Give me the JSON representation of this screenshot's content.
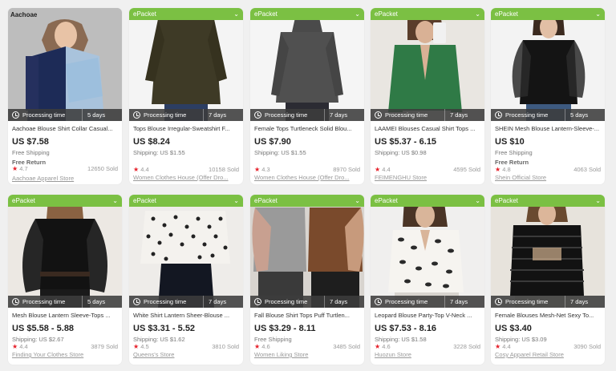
{
  "labels": {
    "epacket": "ePacket",
    "processing": "Processing time",
    "chevron": "⌄"
  },
  "colors": {
    "epacket_bg": "#7bc043",
    "star": "#e6212b",
    "processing_bg": "#3c3c3c"
  },
  "products": [
    {
      "brand_tag": "Aachoae",
      "epacket": false,
      "days": "5 days",
      "title": "Aachoae Blouse Shirt Collar Casual...",
      "price": "US $7.58",
      "shipping": "Free Shipping",
      "free_return": "Free Return",
      "rating": "4.7",
      "sold": "12650 Sold",
      "store": "Aachoae Apparel Store"
    },
    {
      "epacket": true,
      "days": "7 days",
      "title": "Tops Blouse Irregular-Sweatshirt F...",
      "price": "US $8.24",
      "shipping": "Shipping: US $1.55",
      "free_return": "",
      "rating": "4.4",
      "sold": "10158 Sold",
      "store": "Women Clothes House (Offer Dro..."
    },
    {
      "epacket": true,
      "days": "7 days",
      "title": "Female Tops Turtleneck Solid Blou...",
      "price": "US $7.90",
      "shipping": "Shipping: US $1.55",
      "free_return": "",
      "rating": "4.3",
      "sold": "8970 Sold",
      "store": "Women Clothes House (Offer Dro..."
    },
    {
      "epacket": true,
      "days": "7 days",
      "title": "LAAMEI Blouses Casual Shirt Tops ...",
      "price": "US $5.37 - 6.15",
      "shipping": "Shipping: US $0.98",
      "free_return": "",
      "rating": "4.4",
      "sold": "4595 Sold",
      "store": "FEIMENGHU Store"
    },
    {
      "epacket": true,
      "days": "5 days",
      "title": "SHEIN Mesh Blouse Lantern-Sleeve-...",
      "price": "US $10",
      "shipping": "Free Shipping",
      "free_return": "Free Return",
      "rating": "4.8",
      "sold": "4063 Sold",
      "store": "Shein Official Store"
    },
    {
      "epacket": true,
      "days": "5 days",
      "title": "Mesh Blouse Lantern Sleeve-Tops ...",
      "price": "US $5.58 - 5.88",
      "shipping": "Shipping: US $2.67",
      "free_return": "",
      "rating": "4.4",
      "sold": "3879 Sold",
      "store": "Finding Your Clothes Store"
    },
    {
      "epacket": true,
      "days": "7 days",
      "title": "White Shirt Lantern Sheer-Blouse ...",
      "price": "US $3.31 - 5.52",
      "shipping": "Shipping: US $1.62",
      "free_return": "",
      "rating": "4.5",
      "sold": "3810 Sold",
      "store": "Queens's Store"
    },
    {
      "epacket": true,
      "days": "7 days",
      "title": "Fall Blouse Shirt Tops Puff Turtlen...",
      "price": "US $3.29 - 8.11",
      "shipping": "Free Shipping",
      "free_return": "",
      "rating": "4.6",
      "sold": "3485 Sold",
      "store": "Women Liking Store"
    },
    {
      "epacket": true,
      "days": "7 days",
      "title": "Leopard Blouse Party-Top V-Neck ...",
      "price": "US $7.53 - 8.16",
      "shipping": "Shipping: US $1.58",
      "free_return": "",
      "rating": "4.6",
      "sold": "3228 Sold",
      "store": "Huozun Store"
    },
    {
      "epacket": true,
      "days": "7 days",
      "title": "Female Blouses Mesh-Net Sexy To...",
      "price": "US $3.40",
      "shipping": "Shipping: US $3.09",
      "free_return": "",
      "rating": "4.4",
      "sold": "3090 Sold",
      "store": "Cosy Apparel Retail Store"
    }
  ]
}
